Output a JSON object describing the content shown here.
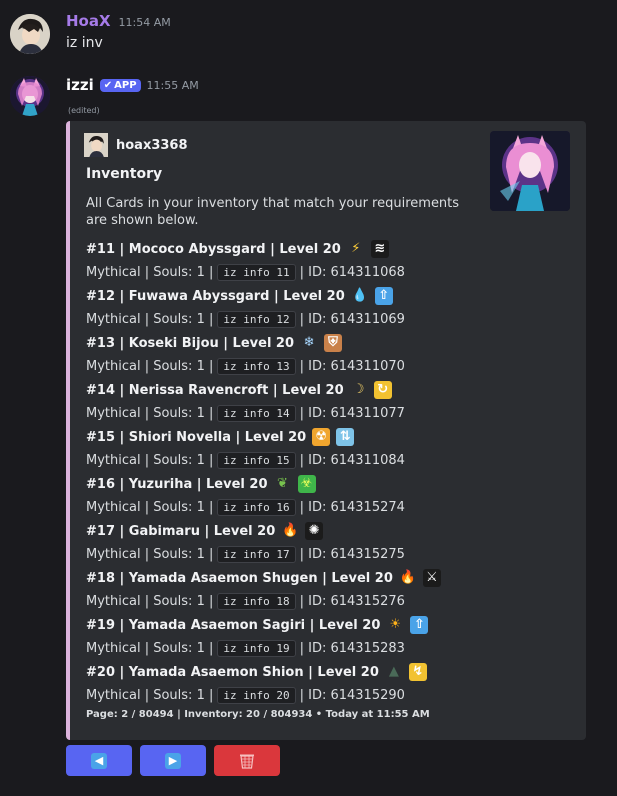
{
  "message1": {
    "username": "HoaX",
    "timestamp": "11:54 AM",
    "text": "iz inv"
  },
  "message2": {
    "username": "izzi",
    "badge": "APP",
    "timestamp": "11:55 AM",
    "edited": "(edited)"
  },
  "embed": {
    "author": "hoax3368",
    "title": "Inventory",
    "description": "All Cards in your inventory that match your requirements are shown below.",
    "accent_color": "#dcb3dc",
    "cards": [
      {
        "title": "#11 |  Mococo Abyssgard | Level 20",
        "details_prefix": "Mythical | Souls: 1 |",
        "command": "iz info 11",
        "details_suffix": "| ID: 614311068",
        "icons": [
          "lightning-icon",
          "wind-slash-icon"
        ]
      },
      {
        "title": "#12 |  Fuwawa Abyssgard | Level 20",
        "details_prefix": "Mythical | Souls: 1 |",
        "command": "iz info 12",
        "details_suffix": "| ID: 614311069",
        "icons": [
          "water-drop-icon",
          "up-arrow-icon"
        ]
      },
      {
        "title": "#13 |  Koseki Bijou | Level 20",
        "details_prefix": "Mythical | Souls: 1 |",
        "command": "iz info 13",
        "details_suffix": "| ID: 614311070",
        "icons": [
          "snowflake-icon",
          "shield-icon"
        ]
      },
      {
        "title": "#14 |  Nerissa Ravencroft | Level 20",
        "details_prefix": "Mythical | Souls: 1 |",
        "command": "iz info 14",
        "details_suffix": "| ID: 614311077",
        "icons": [
          "crescent-moon-icon",
          "cycle-icon"
        ]
      },
      {
        "title": "#15 |  Shiori Novella | Level 20",
        "details_prefix": "Mythical | Souls: 1 |",
        "command": "iz info 15",
        "details_suffix": "| ID: 614311084",
        "icons": [
          "radioactive-icon",
          "transfer-icon"
        ]
      },
      {
        "title": "#16 |  Yuzuriha | Level 20",
        "details_prefix": "Mythical | Souls: 1 |",
        "command": "iz info 16",
        "details_suffix": "| ID: 614315274",
        "icons": [
          "leaf-icon",
          "biohazard-icon"
        ]
      },
      {
        "title": "#17 |  Gabimaru | Level 20",
        "details_prefix": "Mythical | Souls: 1 |",
        "command": "iz info 17",
        "details_suffix": "| ID: 614315275",
        "icons": [
          "fire-icon",
          "explosion-icon"
        ]
      },
      {
        "title": "#18 |  Yamada Asaemon Shugen | Level 20",
        "details_prefix": "Mythical | Souls: 1 |",
        "command": "iz info 18",
        "details_suffix": "| ID: 614315276",
        "icons": [
          "fire-icon",
          "sword-icon"
        ]
      },
      {
        "title": "#19 |  Yamada Asaemon Sagiri | Level 20",
        "details_prefix": "Mythical | Souls: 1 |",
        "command": "iz info 19",
        "details_suffix": "| ID: 614315283",
        "icons": [
          "sun-icon",
          "up-arrow-icon"
        ]
      },
      {
        "title": "#20 |  Yamada Asaemon Shion | Level 20",
        "details_prefix": "Mythical | Souls: 1 |",
        "command": "iz info 20",
        "details_suffix": "| ID: 614315290",
        "icons": [
          "triangle-icon",
          "lightning-bolt-icon"
        ]
      }
    ],
    "footer": "Page: 2 / 80494 | Inventory: 20 / 804934 • Today at 11:55 AM"
  },
  "buttons": {
    "prev_icon": "left-arrow-icon",
    "next_icon": "right-arrow-icon",
    "delete_icon": "wastebasket-icon",
    "prev_color": "#5865f2",
    "next_color": "#5865f2",
    "delete_color": "#da373c"
  }
}
